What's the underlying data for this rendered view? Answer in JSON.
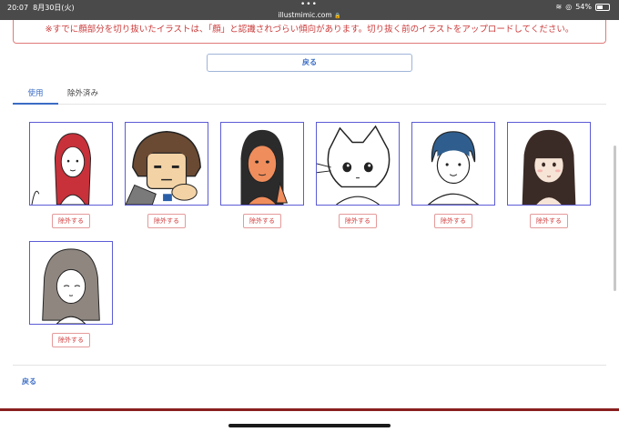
{
  "status_bar": {
    "time": "20:07",
    "date": "8月30日(火)",
    "url": "illustmimic.com",
    "battery": "54%",
    "battery_level": 0.54
  },
  "notice": {
    "text": "※すでに顔部分を切り抜いたイラストは、「顔」と認識されづらい傾向があります。切り抜く前のイラストをアップロードしてください。"
  },
  "back_top_label": "戻る",
  "tabs": [
    {
      "label": "使用",
      "active": true
    },
    {
      "label": "除外済み",
      "active": false
    }
  ],
  "exclude_label": "除外する",
  "images": [
    {
      "label": "red-haired woman"
    },
    {
      "label": "brown-haired character"
    },
    {
      "label": "dark-skinned woman"
    },
    {
      "label": "cat-eared character"
    },
    {
      "label": "blue-haired man"
    },
    {
      "label": "long dark-haired woman"
    },
    {
      "label": "grey-haired woman"
    }
  ],
  "back_bottom_label": "戻る",
  "colors": {
    "accent": "#3b6cc4",
    "danger": "#d23b3b",
    "card_border": "#5b5bd6"
  }
}
